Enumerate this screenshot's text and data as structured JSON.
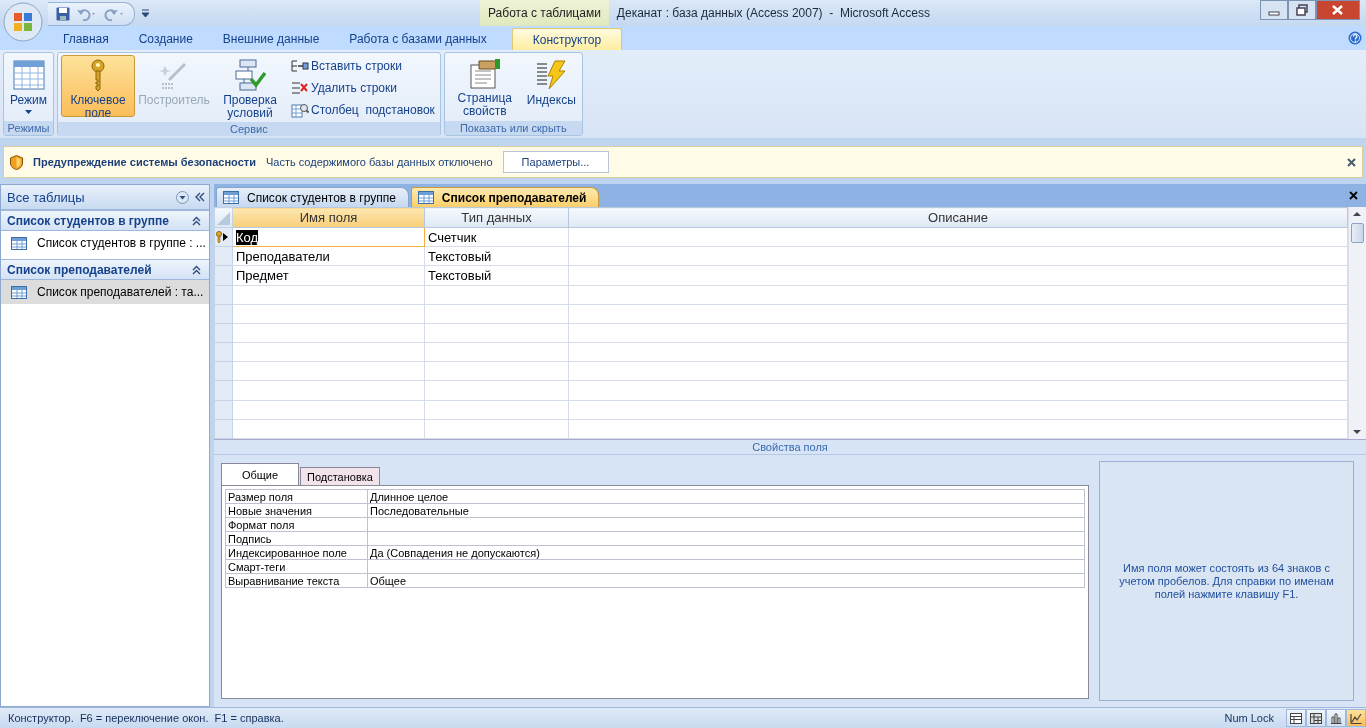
{
  "window": {
    "title": "Деканат : база данных (Access 2007)  -  Microsoft Access",
    "context_tab": "Работа с таблицами"
  },
  "ribbon": {
    "tabs": [
      {
        "label": "Главная",
        "selected": false
      },
      {
        "label": "Создание",
        "selected": false
      },
      {
        "label": "Внешние данные",
        "selected": false
      },
      {
        "label": "Работа с базами данных",
        "selected": false
      },
      {
        "label": "Конструктор",
        "selected": true
      }
    ],
    "groups": [
      {
        "label": "Режимы",
        "buttons": [
          {
            "label": "Режим",
            "kind": "large",
            "dropdown": true,
            "selected": false,
            "disabled": false
          }
        ]
      },
      {
        "label": "Сервис",
        "buttons": [
          {
            "label": "Ключевое поле",
            "kind": "large",
            "selected": true,
            "disabled": false
          },
          {
            "label": "Построитель",
            "kind": "large",
            "selected": false,
            "disabled": true
          },
          {
            "label": "Проверка условий",
            "kind": "large",
            "selected": false,
            "disabled": false
          },
          {
            "label": "Вставить строки",
            "kind": "small",
            "selected": false,
            "disabled": false
          },
          {
            "label": "Удалить строки",
            "kind": "small",
            "selected": false,
            "disabled": false
          },
          {
            "label": "Столбец  подстановок",
            "kind": "small",
            "selected": false,
            "disabled": false
          }
        ]
      },
      {
        "label": "Показать или скрыть",
        "buttons": [
          {
            "label": "Страница свойств",
            "kind": "large",
            "selected": false,
            "disabled": false
          },
          {
            "label": "Индексы",
            "kind": "large",
            "selected": false,
            "disabled": false
          }
        ]
      }
    ]
  },
  "security_bar": {
    "title": "Предупреждение системы безопасности",
    "message": "Часть содержимого базы данных отключено",
    "button": "Параметры..."
  },
  "navigation": {
    "header": "Все таблицы",
    "groups": [
      {
        "title": "Список студентов в группе",
        "expanded": true,
        "items": [
          {
            "label": "Список студентов в группе : ...",
            "selected": false
          }
        ]
      },
      {
        "title": "Список преподавателей",
        "expanded": true,
        "items": [
          {
            "label": "Список преподавателей : та...",
            "selected": true
          }
        ]
      }
    ]
  },
  "document_tabs": [
    {
      "label": "Список студентов в группе",
      "selected": false
    },
    {
      "label": "Список преподавателей",
      "selected": true
    }
  ],
  "design_grid": {
    "columns": [
      "Имя поля",
      "Тип данных",
      "Описание"
    ],
    "rows": [
      {
        "name": "Код",
        "type": "Счетчик",
        "primary_key": true,
        "current": true
      },
      {
        "name": "Преподаватели",
        "type": "Текстовый",
        "primary_key": false,
        "current": false
      },
      {
        "name": "Предмет",
        "type": "Текстовый",
        "primary_key": false,
        "current": false
      }
    ]
  },
  "field_properties": {
    "title": "Свойства поля",
    "tabs": [
      {
        "label": "Общие",
        "selected": true
      },
      {
        "label": "Подстановка",
        "selected": false
      }
    ],
    "rows": [
      {
        "label": "Размер поля",
        "value": "Длинное целое"
      },
      {
        "label": "Новые значения",
        "value": "Последовательные"
      },
      {
        "label": "Формат поля"
      },
      {
        "label": "Подпись"
      },
      {
        "label": "Индексированное поле",
        "value": "Да (Совпадения не допускаются)"
      },
      {
        "label": "Смарт-теги"
      },
      {
        "label": "Выравнивание текста",
        "value": "Общее"
      }
    ],
    "help": "Имя поля может состоять из 64 знаков с учетом пробелов.  Для справки по именам полей нажмите клавишу F1."
  },
  "status_bar": {
    "text": "Конструктор.  F6 = переключение окон.  F1 = справка.",
    "indicator": "Num Lock",
    "views": [
      {
        "selected": false
      },
      {
        "selected": false
      },
      {
        "selected": false
      },
      {
        "selected": true
      }
    ]
  }
}
